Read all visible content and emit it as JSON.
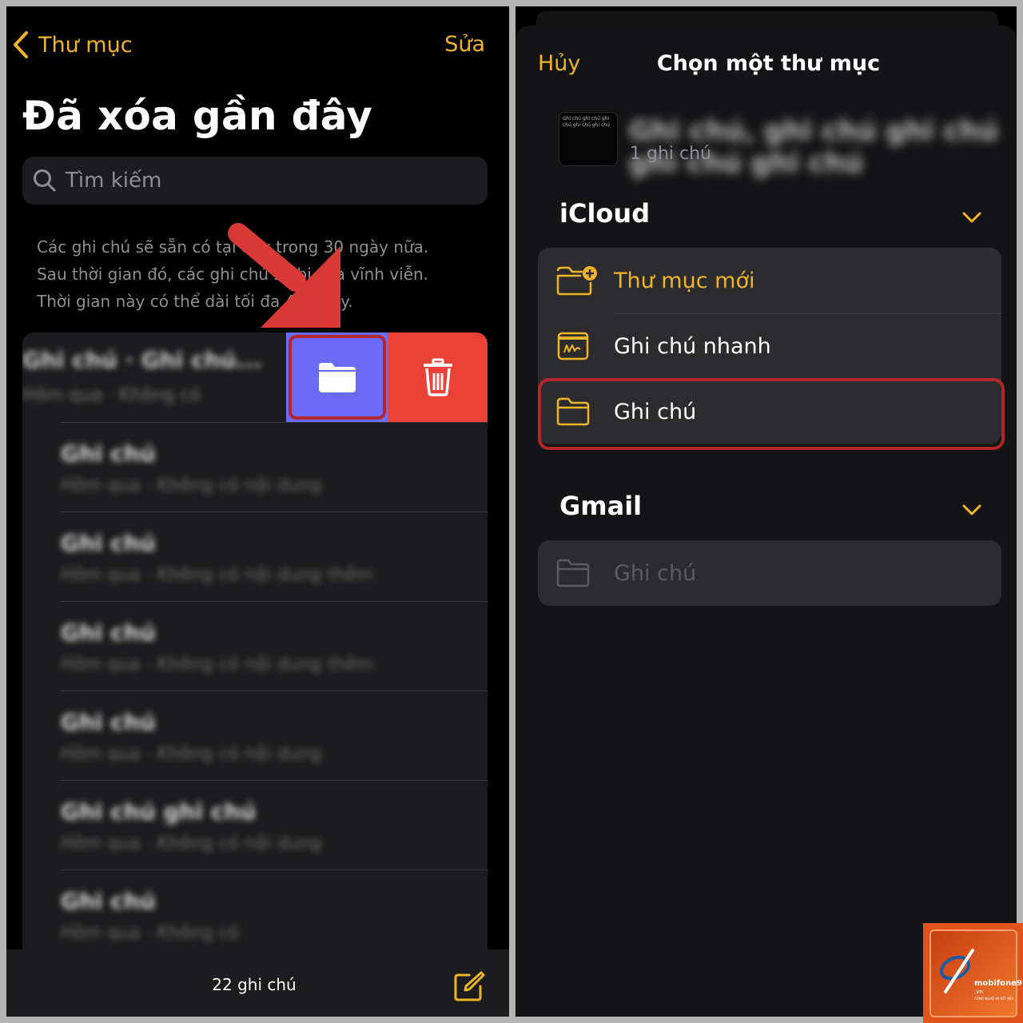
{
  "left": {
    "nav": {
      "back_label": "Thư mục",
      "edit_label": "Sửa"
    },
    "title": "Đã xóa gần đây",
    "search": {
      "placeholder": "Tìm kiếm"
    },
    "info_lines": [
      "Các ghi chú sẽ sẵn có tại đây trong 30 ngày nữa.",
      "Sau thời gian đó, các ghi chú sẽ bị xóa vĩnh viễn.",
      "Thời gian này có thể dài tối đa 40 ngày."
    ],
    "first_note": {
      "title": "Ghi chú · Ghi chú...",
      "subtitle": "Hôm qua · Không có"
    },
    "notes": [
      {
        "title": "Ghi chú",
        "subtitle": "Hôm qua · Không có nội dung"
      },
      {
        "title": "Ghi chú",
        "subtitle": "Hôm qua · Không có nội dung thêm"
      },
      {
        "title": "Ghi chú",
        "subtitle": "Hôm qua · Không có nội dung thêm"
      },
      {
        "title": "Ghi chú",
        "subtitle": "Hôm qua · Không có nội dung"
      },
      {
        "title": "Ghi chú ghi chú",
        "subtitle": "Hôm qua · Không có nội dung"
      },
      {
        "title": "Ghi chú",
        "subtitle": "Hôm qua · Không có"
      }
    ],
    "toolbar": {
      "count": "22 ghi chú"
    }
  },
  "right": {
    "sheet": {
      "cancel_label": "Hủy",
      "title": "Chọn một thư mục"
    },
    "selected_note": {
      "thumb_text": "Ghi chú ghi chú ghi chú ghi chú ghi chú",
      "name": "Ghi chú, ghi chú ghi chú ghi chú ghi chú",
      "count": "1 ghi chú"
    },
    "icloud": {
      "header": "iCloud",
      "items": [
        {
          "label": "Thư mục mới",
          "color": "#f0b429"
        },
        {
          "label": "Ghi chú nhanh",
          "color": "#ffffff"
        },
        {
          "label": "Ghi chú",
          "color": "#ffffff"
        }
      ]
    },
    "gmail": {
      "header": "Gmail",
      "items": [
        {
          "label": "Ghi chú",
          "color": "#5c5c60"
        }
      ]
    }
  },
  "watermark": {
    "brand": "mobifone9",
    "domain": ".vn",
    "tagline": "CÔNG NGHỆ VÀ KẾT NỐI"
  },
  "colors": {
    "accent": "#f0b429",
    "move": "#6b6cf6",
    "delete": "#ec4136",
    "highlight": "#b3262b"
  }
}
